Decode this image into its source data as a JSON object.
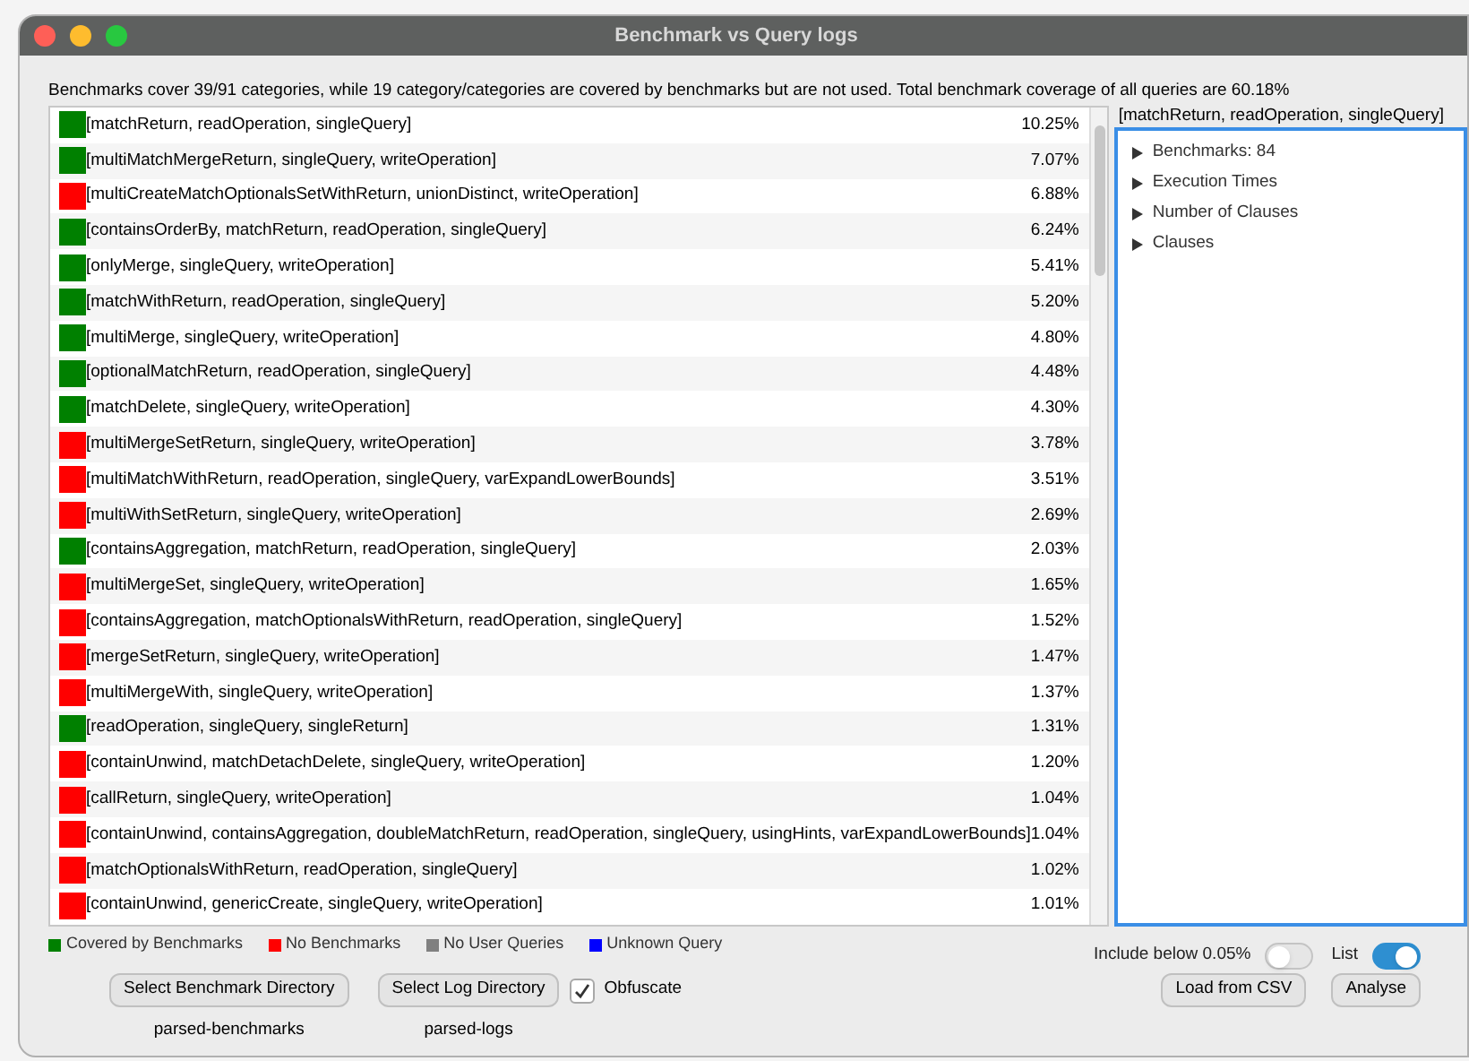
{
  "window": {
    "title": "Benchmark vs Query logs"
  },
  "summary": "Benchmarks cover 39/91 categories, while 19 category/categories are covered by benchmarks but are not used. Total benchmark coverage of all queries are 60.18%",
  "rows": [
    {
      "name": "[matchReturn, readOperation, singleQuery]",
      "share": "10.25%",
      "color": "#008000"
    },
    {
      "name": "[multiMatchMergeReturn, singleQuery, writeOperation]",
      "share": "7.07%",
      "color": "#008000"
    },
    {
      "name": "[multiCreateMatchOptionalsSetWithReturn, unionDistinct, writeOperation]",
      "share": "6.88%",
      "color": "#ff0000"
    },
    {
      "name": "[containsOrderBy, matchReturn, readOperation, singleQuery]",
      "share": "6.24%",
      "color": "#008000"
    },
    {
      "name": "[onlyMerge, singleQuery, writeOperation]",
      "share": "5.41%",
      "color": "#008000"
    },
    {
      "name": "[matchWithReturn, readOperation, singleQuery]",
      "share": "5.20%",
      "color": "#008000"
    },
    {
      "name": "[multiMerge, singleQuery, writeOperation]",
      "share": "4.80%",
      "color": "#008000"
    },
    {
      "name": "[optionalMatchReturn, readOperation, singleQuery]",
      "share": "4.48%",
      "color": "#008000"
    },
    {
      "name": "[matchDelete, singleQuery, writeOperation]",
      "share": "4.30%",
      "color": "#008000"
    },
    {
      "name": "[multiMergeSetReturn, singleQuery, writeOperation]",
      "share": "3.78%",
      "color": "#ff0000"
    },
    {
      "name": "[multiMatchWithReturn, readOperation, singleQuery, varExpandLowerBounds]",
      "share": "3.51%",
      "color": "#ff0000"
    },
    {
      "name": "[multiWithSetReturn, singleQuery, writeOperation]",
      "share": "2.69%",
      "color": "#ff0000"
    },
    {
      "name": "[containsAggregation, matchReturn, readOperation, singleQuery]",
      "share": "2.03%",
      "color": "#008000"
    },
    {
      "name": "[multiMergeSet, singleQuery, writeOperation]",
      "share": "1.65%",
      "color": "#ff0000"
    },
    {
      "name": "[containsAggregation, matchOptionalsWithReturn, readOperation, singleQuery]",
      "share": "1.52%",
      "color": "#ff0000"
    },
    {
      "name": "[mergeSetReturn, singleQuery, writeOperation]",
      "share": "1.47%",
      "color": "#ff0000"
    },
    {
      "name": "[multiMergeWith, singleQuery, writeOperation]",
      "share": "1.37%",
      "color": "#ff0000"
    },
    {
      "name": "[readOperation, singleQuery, singleReturn]",
      "share": "1.31%",
      "color": "#008000"
    },
    {
      "name": "[containUnwind, matchDetachDelete, singleQuery, writeOperation]",
      "share": "1.20%",
      "color": "#ff0000"
    },
    {
      "name": "[callReturn, singleQuery, writeOperation]",
      "share": "1.04%",
      "color": "#ff0000"
    },
    {
      "name": "[containUnwind, containsAggregation, doubleMatchReturn, readOperation, singleQuery, usingHints, varExpandLowerBounds]",
      "share": "1.04%",
      "color": "#ff0000"
    },
    {
      "name": "[matchOptionalsWithReturn, readOperation, singleQuery]",
      "share": "1.02%",
      "color": "#ff0000"
    },
    {
      "name": "[containUnwind, genericCreate, singleQuery, writeOperation]",
      "share": "1.01%",
      "color": "#ff0000"
    }
  ],
  "details": {
    "title": "[matchReturn, readOperation, singleQuery]",
    "tree": [
      {
        "label": "Benchmarks: 84",
        "expanded": false
      },
      {
        "label": "Execution Times",
        "expanded": false
      },
      {
        "label": "Number of Clauses",
        "expanded": false
      },
      {
        "label": "Clauses",
        "expanded": false
      }
    ]
  },
  "legend": [
    {
      "label": "Covered by Benchmarks",
      "color": "#008000"
    },
    {
      "label": "No Benchmarks",
      "color": "#ff0000"
    },
    {
      "label": "No User Queries",
      "color": "#808080"
    },
    {
      "label": "Unknown Query",
      "color": "#0000ff"
    }
  ],
  "toggles": [
    {
      "label": "Include below 0.05%",
      "on": false
    },
    {
      "label": "List",
      "on": true
    }
  ],
  "benchmark_dir": {
    "button": "Select Benchmark Directory",
    "path": "parsed-benchmarks"
  },
  "log_dir": {
    "button": "Select Log Directory",
    "path": "parsed-logs"
  },
  "obfuscate": {
    "label": "Obfuscate",
    "checked": true
  },
  "buttons": [
    "Load from CSV",
    "Analyse"
  ]
}
